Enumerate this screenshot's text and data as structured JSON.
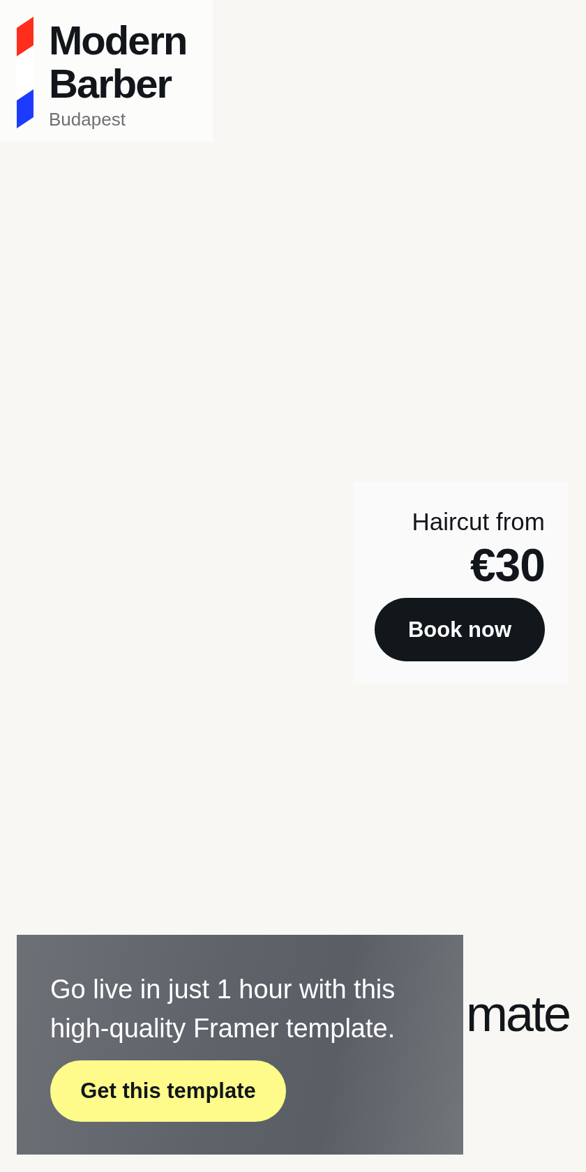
{
  "logo": {
    "title": "Modern Barber",
    "subtitle": "Budapest"
  },
  "price_card": {
    "label": "Haircut from",
    "price": "€30",
    "button": "Book now"
  },
  "hero": {
    "heading_visible": "mate"
  },
  "promo_banner": {
    "text": "Go live in just 1 hour with this high-quality Framer template.",
    "button": "Get this template"
  }
}
